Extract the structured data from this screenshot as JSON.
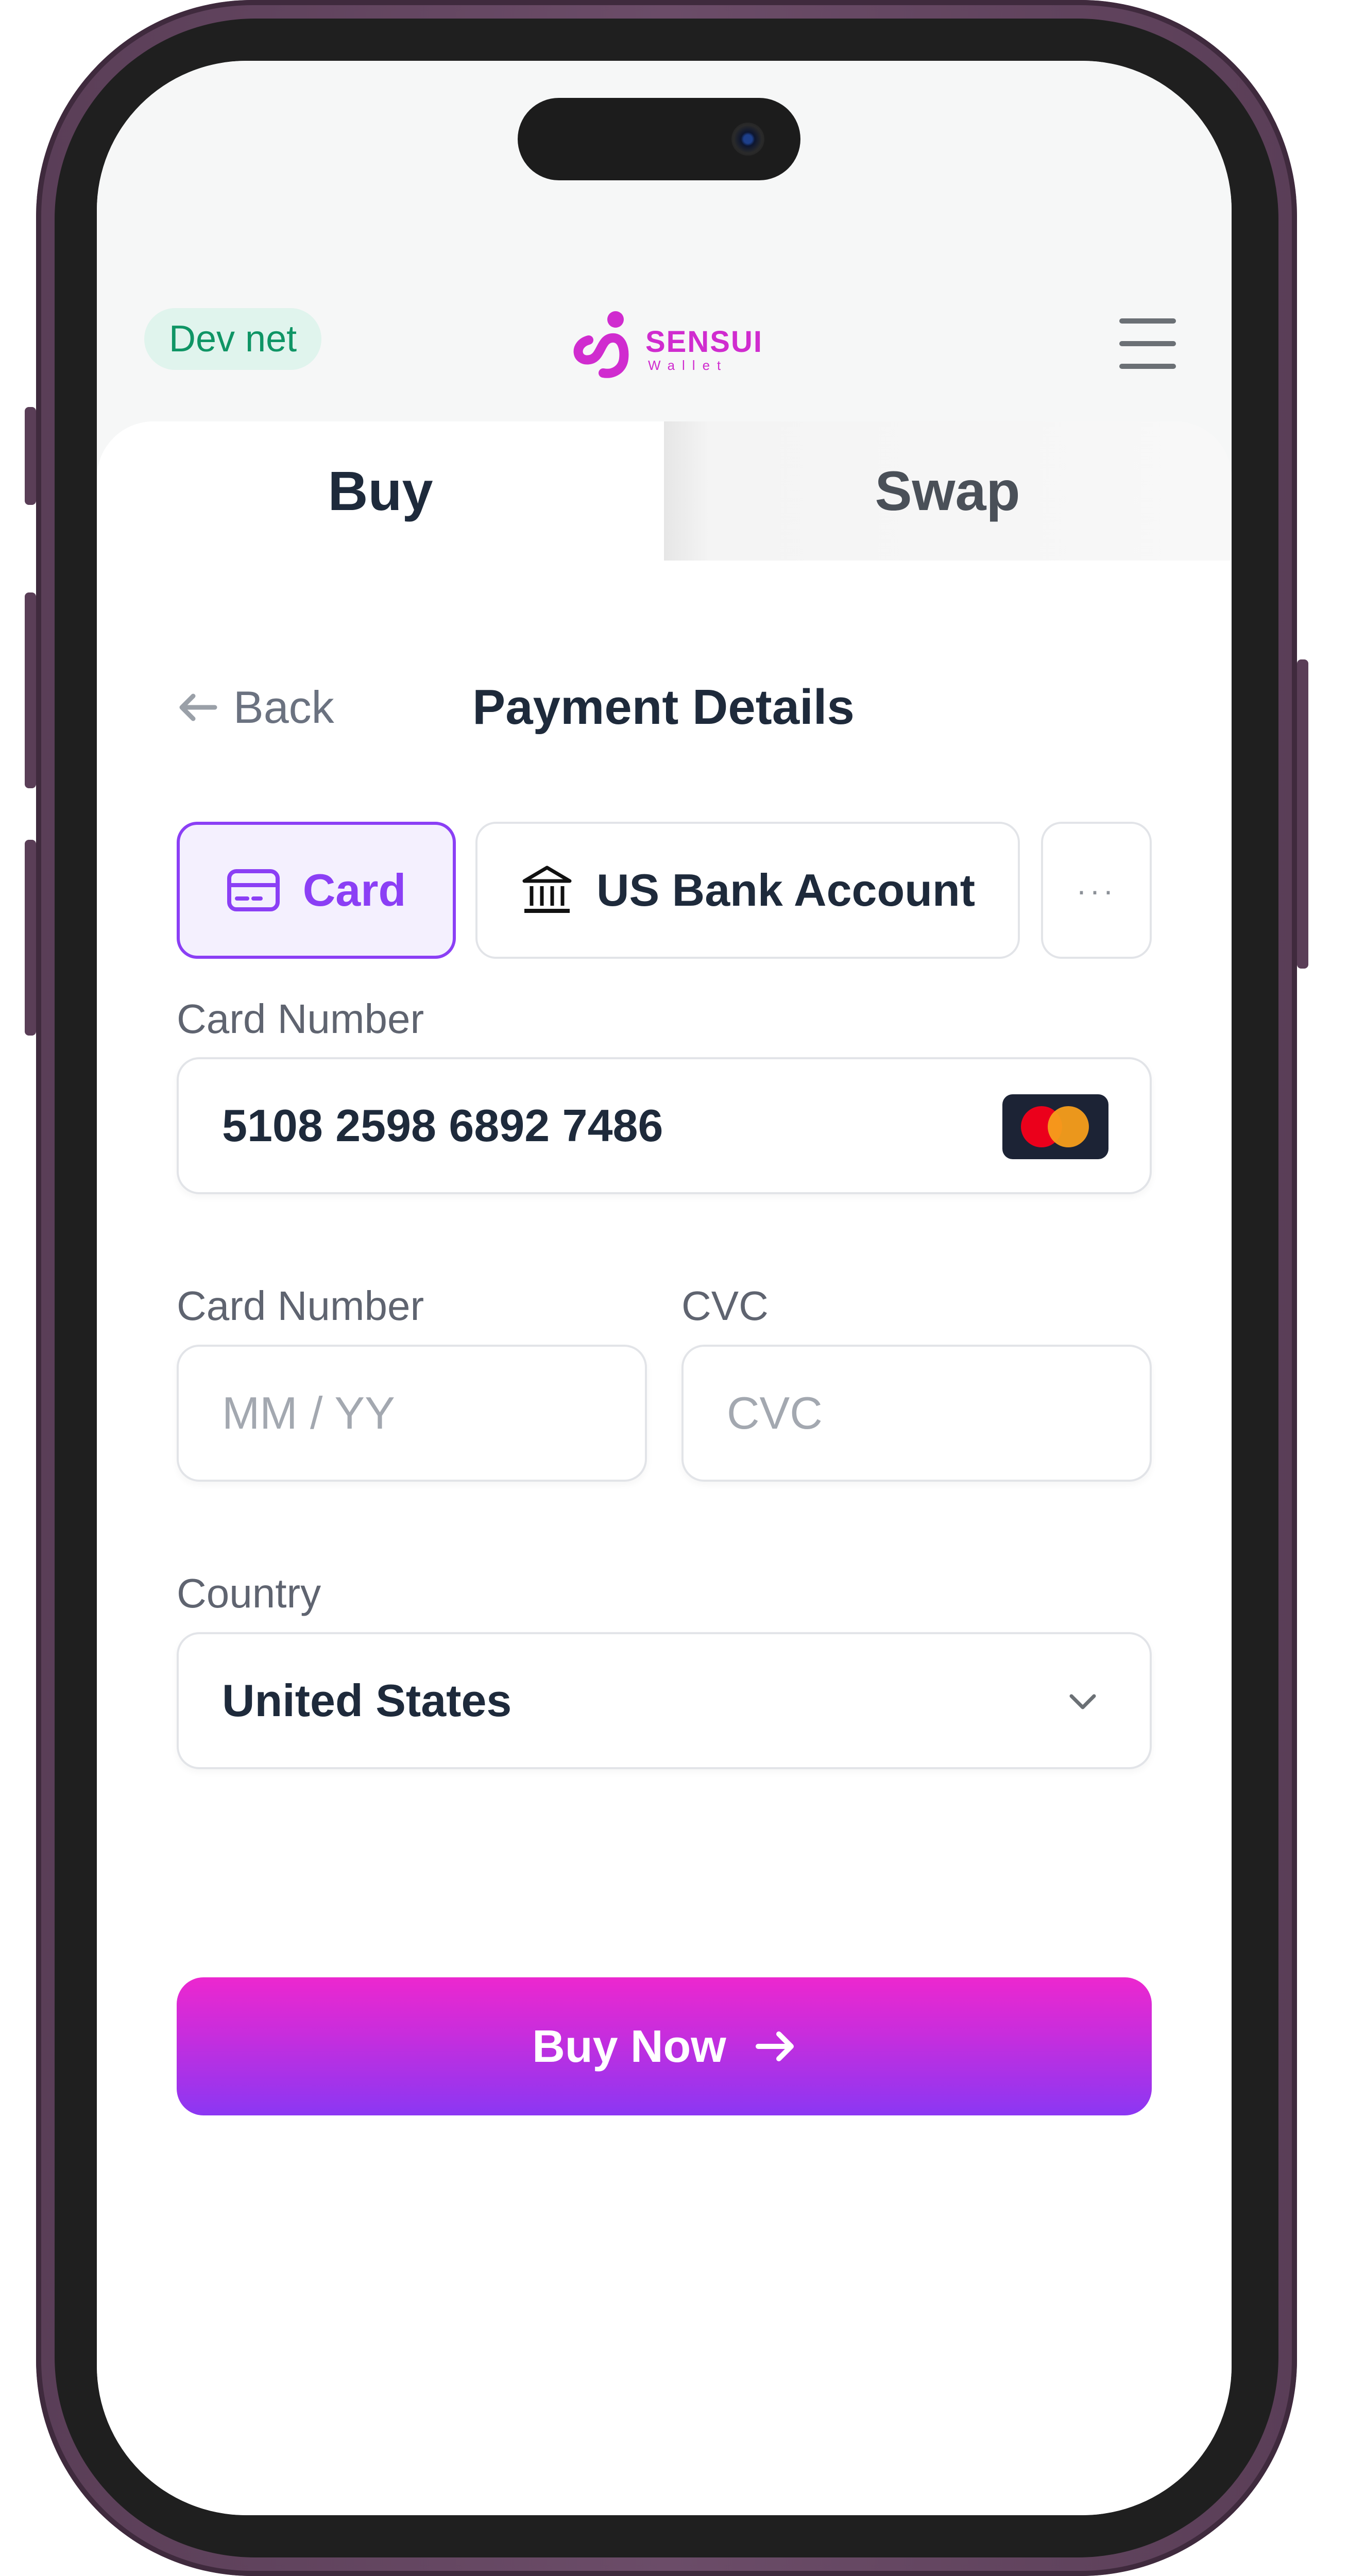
{
  "header": {
    "env_badge": "Dev net",
    "logo": {
      "name": "SENSUI",
      "sub": "Wallet",
      "color": "#d02ccf"
    },
    "menu_icon": "hamburger-menu-icon"
  },
  "tabs": [
    {
      "label": "Buy",
      "active": true
    },
    {
      "label": "Swap",
      "active": false
    }
  ],
  "payment": {
    "back_label": "Back",
    "title": "Payment Details",
    "methods": [
      {
        "label": "Card",
        "icon": "credit-card-icon",
        "selected": true
      },
      {
        "label": "US Bank Account",
        "icon": "bank-icon",
        "selected": false
      },
      {
        "label": "···",
        "icon": "more-icon",
        "selected": false
      }
    ],
    "card_number_label": "Card Number",
    "card_number_value": "5108 2598 6892 7486",
    "card_brand_icon": "mastercard-icon",
    "expiry_label": "Card Number",
    "expiry_placeholder": "MM / YY",
    "cvc_label": "CVC",
    "cvc_placeholder": "CVC",
    "country_label": "Country",
    "country_value": "United States",
    "submit_label": "Buy Now"
  },
  "colors": {
    "accent": "#8b3ff5",
    "badge_bg": "#e0f4ed",
    "badge_text": "#0f9565",
    "button_gradient_top": "#ec27cf",
    "button_gradient_bottom": "#8b37f3"
  }
}
